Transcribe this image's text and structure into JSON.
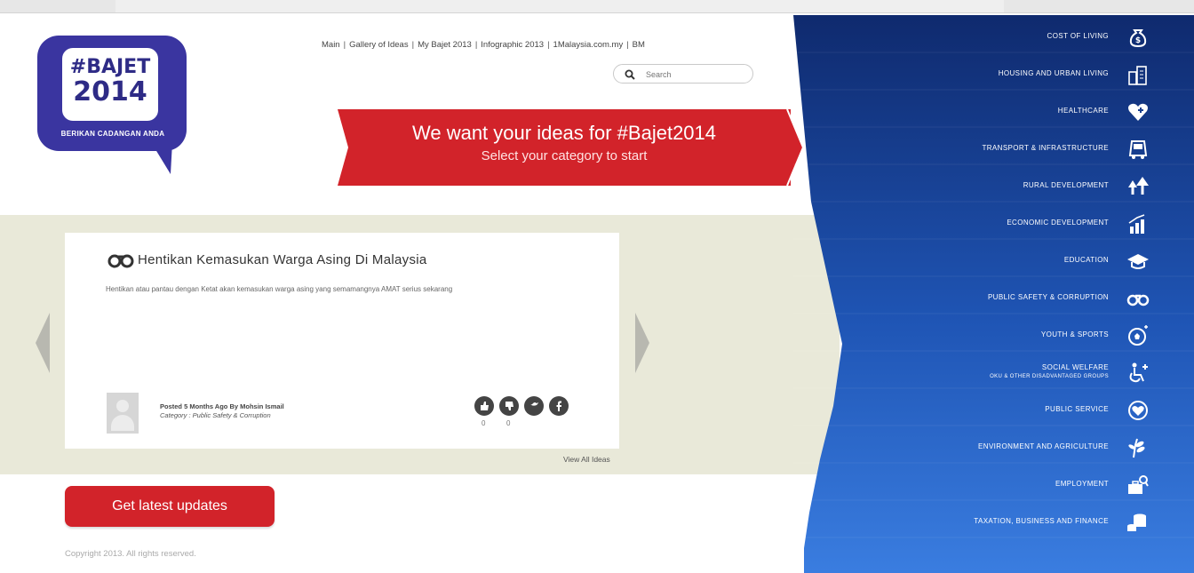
{
  "logo": {
    "line1": "#BAJET",
    "line2": "2014",
    "tagline": "BERIKAN CADANGAN ANDA"
  },
  "nav": {
    "links": [
      "Main",
      "Gallery of Ideas",
      "My Bajet 2013",
      "Infographic 2013",
      "1Malaysia.com.my",
      "BM"
    ],
    "separator": "|"
  },
  "search": {
    "placeholder": "Search"
  },
  "banner": {
    "title": "We want your ideas for #Bajet2014",
    "subtitle": "Select your category to start"
  },
  "idea": {
    "title": "Hentikan Kemasukan Warga Asing Di Malaysia",
    "description": "Hentikan atau pantau dengan Ketat akan kemasukan warga asing yang semamangnya AMAT serius sekarang",
    "posted": "Posted 5 Months Ago By Mohsin Ismail",
    "category": "Category : Public Safety & Corruption",
    "likes": "0",
    "dislikes": "0",
    "view_all": "View All Ideas"
  },
  "cta": {
    "label": "Get latest updates"
  },
  "footer": {
    "copyright": "Copyright 2013. All rights reserved."
  },
  "colors": {
    "brand_red": "#d2232a",
    "brand_purple": "#3a35a0",
    "sidebar_top": "#0f2a6e",
    "sidebar_bottom": "#3a7de0",
    "band": "#e9e9d9"
  },
  "categories": [
    {
      "label": "COST OF LIVING",
      "icon": "money-bag-icon"
    },
    {
      "label": "HOUSING AND URBAN LIVING",
      "icon": "buildings-icon"
    },
    {
      "label": "HEALTHCARE",
      "icon": "heart-plus-icon"
    },
    {
      "label": "TRANSPORT & INFRASTRUCTURE",
      "icon": "bus-icon"
    },
    {
      "label": "RURAL DEVELOPMENT",
      "icon": "trees-icon"
    },
    {
      "label": "ECONOMIC DEVELOPMENT",
      "icon": "growth-chart-icon"
    },
    {
      "label": "EDUCATION",
      "icon": "graduation-cap-icon"
    },
    {
      "label": "PUBLIC SAFETY & CORRUPTION",
      "icon": "handcuffs-icon"
    },
    {
      "label": "YOUTH & SPORTS",
      "icon": "football-icon"
    },
    {
      "label": "SOCIAL WELFARE",
      "sub": "OKU & OTHER DISADVANTAGED GROUPS",
      "icon": "wheelchair-icon"
    },
    {
      "label": "PUBLIC SERVICE",
      "icon": "heart-badge-icon"
    },
    {
      "label": "ENVIRONMENT AND AGRICULTURE",
      "icon": "wheat-icon"
    },
    {
      "label": "EMPLOYMENT",
      "icon": "briefcase-search-icon"
    },
    {
      "label": "TAXATION, BUSINESS AND FINANCE",
      "icon": "coins-icon"
    }
  ]
}
